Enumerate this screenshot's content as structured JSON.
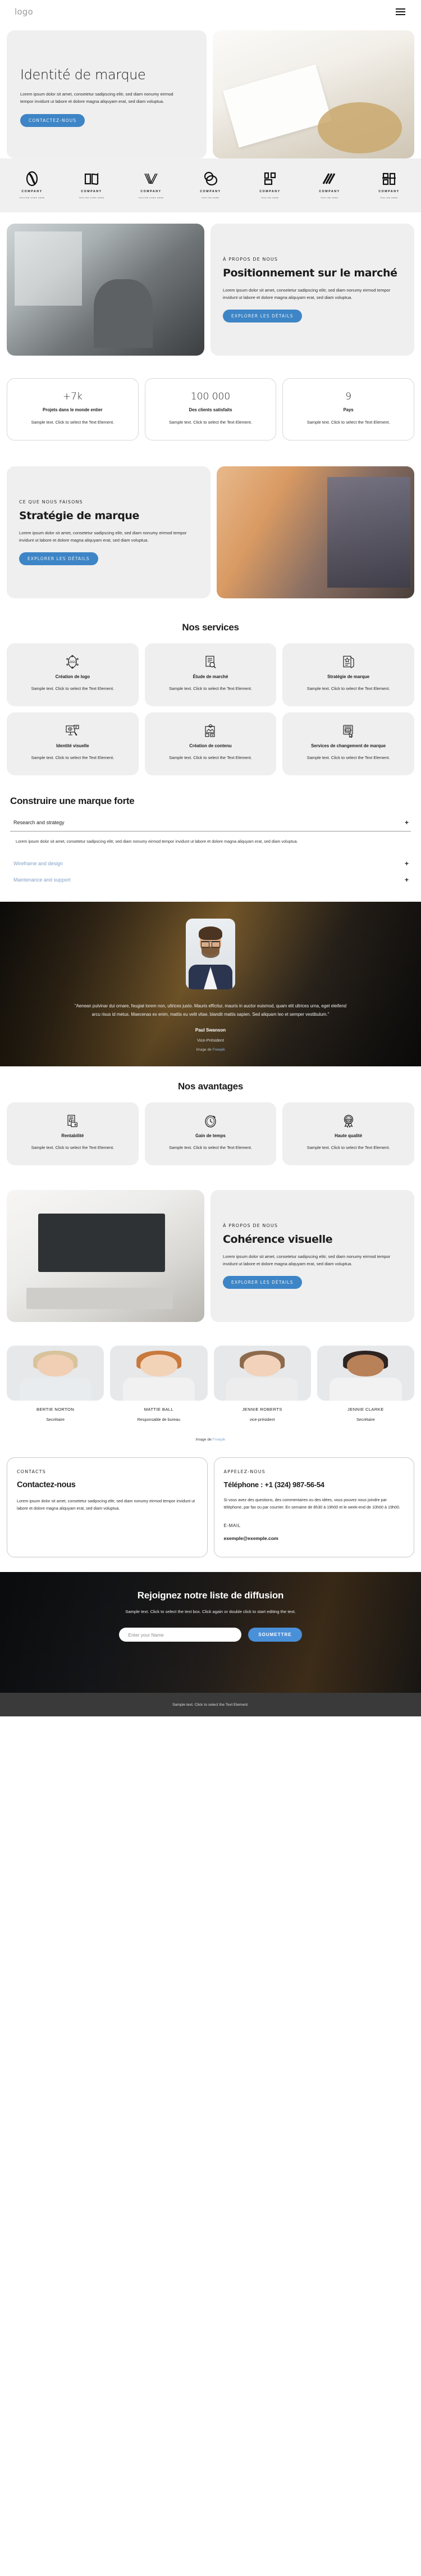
{
  "header": {
    "logo": "logo",
    "menu_icon": "hamburger-menu"
  },
  "hero": {
    "title": "Identité de marque",
    "paragraph": "Lorem ipsum dolor sit amet, consetetur sadipscing elitr, sed diam nonumy eirmod tempor invidunt ut labore et dolore magna aliquyam erat, sed diam voluptua.",
    "cta": "CONTACTEZ-NOUS"
  },
  "logo_strip": [
    {
      "name": "COMPANY",
      "tagline": "TAGLINE GOES HERE",
      "mark": "oval-knot-mark"
    },
    {
      "name": "COMPANY",
      "tagline": "TAGLINE GOES HERE",
      "mark": "open-book-mark"
    },
    {
      "name": "COMPANY",
      "tagline": "TAGLINE GOES HERE",
      "mark": "check-lines-mark"
    },
    {
      "name": "COMPANY",
      "tagline": "TAGLINE HERE",
      "mark": "double-circle-mark"
    },
    {
      "name": "COMPANY",
      "tagline": "TAGLINE HERE",
      "mark": "square-bracket-mark"
    },
    {
      "name": "COMPANY",
      "tagline": "TAGLINE HERE",
      "mark": "diagonal-slashes-mark"
    },
    {
      "name": "COMPANY",
      "tagline": "TAGLINE HERE",
      "mark": "letter-blocks-mark"
    }
  ],
  "about_market": {
    "eyebrow": "À PROPOS DE NOUS",
    "title": "Positionnement sur le marché",
    "paragraph": "Lorem ipsum dolor sit amet, consetetur sadipscing elitr, sed diam nonumy eirmod tempor invidunt ut labore et dolore magna aliquyam erat, sed diam voluptua.",
    "cta": "EXPLORER LES DÉTAILS",
    "image_alt": "office-workspace-photo"
  },
  "stats": [
    {
      "value": "+7k",
      "label": "Projets dans le monde entier",
      "desc": "Sample text. Click to select the Text Element."
    },
    {
      "value": "100 000",
      "label": "Des clients satisfaits",
      "desc": "Sample text. Click to select the Text Element."
    },
    {
      "value": "9",
      "label": "Pays",
      "desc": "Sample text. Click to select the Text Element."
    }
  ],
  "strategy": {
    "eyebrow": "CE QUE NOUS FAISONS",
    "title": "Stratégie de marque",
    "paragraph": "Lorem ipsum dolor sit amet, consetetur sadipscing elitr, sed diam nonumy eirmod tempor invidunt ut labore et dolore magna aliquyam erat, sed diam voluptua.",
    "cta": "EXPLORER LES DÉTAILS",
    "image_alt": "hands-holding-photo"
  },
  "services": {
    "title": "Nos services",
    "items": [
      {
        "icon": "logo-design-icon",
        "title": "Création de logo",
        "desc": "Sample text. Click to select the Text Element."
      },
      {
        "icon": "market-research-icon",
        "title": "Étude de marché",
        "desc": "Sample text. Click to select the Text Element."
      },
      {
        "icon": "brand-strategy-icon",
        "title": "Stratégie de marque",
        "desc": "Sample text. Click to select the Text Element."
      },
      {
        "icon": "visual-identity-icon",
        "title": "Identité visuelle",
        "desc": "Sample text. Click to select the Text Element."
      },
      {
        "icon": "content-creation-icon",
        "title": "Création de contenu",
        "desc": "Sample text. Click to select the Text Element."
      },
      {
        "icon": "rebranding-icon",
        "title": "Services de changement de marque",
        "desc": "Sample text. Click to select the Text Element."
      }
    ]
  },
  "accordion": {
    "title": "Construire une marque forte",
    "items": [
      {
        "label": "Research and strategy",
        "open": true,
        "toggle": "+",
        "body": "Lorem ipsum dolor sit amet, consetetur sadipscing elitr, sed diam nonumy eirmod tempor invidunt ut labore et dolore magna aliquyam erat, sed diam voluptua."
      },
      {
        "label": "Wireframe and design",
        "open": false,
        "toggle": "+",
        "body": ""
      },
      {
        "label": "Maintenance and support",
        "open": false,
        "toggle": "+",
        "body": ""
      }
    ]
  },
  "testimonial": {
    "quote": "\"Aenean pulvinar dui ornare, feugiat lorem non, ultrices justo. Mauris efficitur, mauris in auctor euismod, quam elit ultrices urna, eget eleifend arcu risus id metus. Maecenas ex enim, mattis eu velit vitae, blandit mattis sapien. Sed aliquam leo et semper vestibulum.\"",
    "name": "Paul Swanson",
    "role": "Vice-Président",
    "credit_prefix": "Image de ",
    "credit_link": "Freepik",
    "avatar_alt": "man-with-glasses-portrait"
  },
  "advantages": {
    "title": "Nos avantages",
    "items": [
      {
        "icon": "cost-efficiency-icon",
        "title": "Rentabilité",
        "desc": "Sample text. Click to select the Text Element."
      },
      {
        "icon": "clock-icon",
        "title": "Gain de temps",
        "desc": "Sample text. Click to select the Text Element."
      },
      {
        "icon": "high-quality-badge-icon",
        "title": "Haute qualité",
        "desc": "Sample text. Click to select the Text Element."
      }
    ]
  },
  "about_visual": {
    "eyebrow": "À PROPOS DE NOUS",
    "title": "Cohérence visuelle",
    "paragraph": "Lorem ipsum dolor sit amet, consetetur sadipscing elitr, sed diam nonumy eirmod tempor invidunt ut labore et dolore magna aliquyam erat, sed diam voluptua.",
    "cta": "EXPLORER LES DÉTAILS",
    "image_alt": "laptop-desk-photo"
  },
  "team": {
    "members": [
      {
        "name": "BERTIE NORTON",
        "role": "Secrétaire",
        "photo_alt": "woman-blonde-portrait"
      },
      {
        "name": "MATTIE BALL",
        "role": "Responsable de bureau",
        "photo_alt": "man-beard-portrait"
      },
      {
        "name": "JENNIE ROBERTS",
        "role": "vice-président",
        "photo_alt": "woman-bob-portrait"
      },
      {
        "name": "JENNIE CLARKE",
        "role": "Secrétaire",
        "photo_alt": "woman-curly-portrait"
      }
    ],
    "credit_prefix": "Image de ",
    "credit_link": "Freepik"
  },
  "contacts": {
    "left": {
      "eyebrow": "CONTACTS",
      "title": "Contactez-nous",
      "paragraph": "Lorem ipsum dolor sit amet, consetetur sadipscing elitr, sed diam nonumy eirmod tempor invidunt ut labore et dolore magna aliquyam erat, sed diam voluptua."
    },
    "right": {
      "eyebrow": "APPELEZ-NOUS",
      "title": "Téléphone : +1 (324) 987-56-54",
      "paragraph": "Si vous avez des questions, des commentaires ou des idées, vous pouvez nous joindre par téléphone, par fax ou par courrier. En semaine de 8h30 à 19h00 et le week-end de 10h00 à 19h00.",
      "email_label": "E-MAIL",
      "email": "exemple@exemple.com"
    }
  },
  "newsletter": {
    "title": "Rejoignez notre liste de diffusion",
    "subtitle": "Sample text. Click to select the text box. Click again or double click to start editing the text.",
    "input_placeholder": "Enter your Name",
    "input_value": "",
    "button": "SOUMETTRE"
  },
  "footer": {
    "text": "Sample text. Click to select the Text Element."
  },
  "colors": {
    "accent": "#3d85c6",
    "accent_button": "#4a90d9",
    "card_bg": "#efefef",
    "footer_bg": "#3a3a3a"
  }
}
